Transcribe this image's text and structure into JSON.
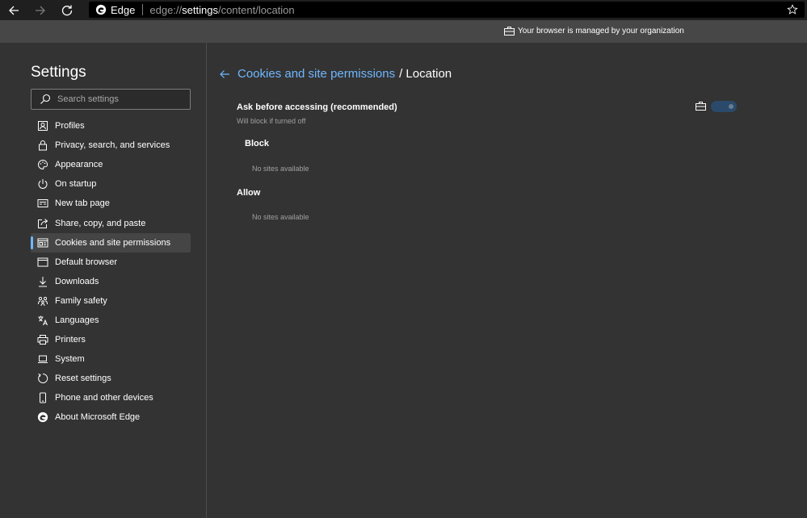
{
  "browser": {
    "site_name": "Edge",
    "url_prefix": "edge://",
    "url_highlight": "settings",
    "url_suffix": "/content/location"
  },
  "managed_banner": {
    "text": "Your browser is managed by your organization"
  },
  "sidebar": {
    "title": "Settings",
    "search_placeholder": "Search settings",
    "items": [
      {
        "label": "Profiles",
        "icon": "profile-icon"
      },
      {
        "label": "Privacy, search, and services",
        "icon": "lock-icon"
      },
      {
        "label": "Appearance",
        "icon": "palette-icon"
      },
      {
        "label": "On startup",
        "icon": "power-icon"
      },
      {
        "label": "New tab page",
        "icon": "new-tab-icon"
      },
      {
        "label": "Share, copy, and paste",
        "icon": "share-icon"
      },
      {
        "label": "Cookies and site permissions",
        "icon": "cookies-icon",
        "active": true
      },
      {
        "label": "Default browser",
        "icon": "browser-icon"
      },
      {
        "label": "Downloads",
        "icon": "download-icon"
      },
      {
        "label": "Family safety",
        "icon": "family-icon"
      },
      {
        "label": "Languages",
        "icon": "languages-icon"
      },
      {
        "label": "Printers",
        "icon": "printer-icon"
      },
      {
        "label": "System",
        "icon": "laptop-icon"
      },
      {
        "label": "Reset settings",
        "icon": "reset-icon"
      },
      {
        "label": "Phone and other devices",
        "icon": "phone-icon"
      },
      {
        "label": "About Microsoft Edge",
        "icon": "edge-logo-icon"
      }
    ]
  },
  "main": {
    "breadcrumb_link": "Cookies and site permissions",
    "breadcrumb_current": "/ Location",
    "setting_title": "Ask before accessing (recommended)",
    "setting_subtitle": "Will block if turned off",
    "toggle_on": true,
    "block_title": "Block",
    "block_empty": "No sites available",
    "allow_title": "Allow",
    "allow_empty": "No sites available"
  },
  "colors": {
    "accent": "#6fb7ff",
    "background": "#333333",
    "toolbar": "#1f1f1f",
    "banner": "#474747"
  }
}
